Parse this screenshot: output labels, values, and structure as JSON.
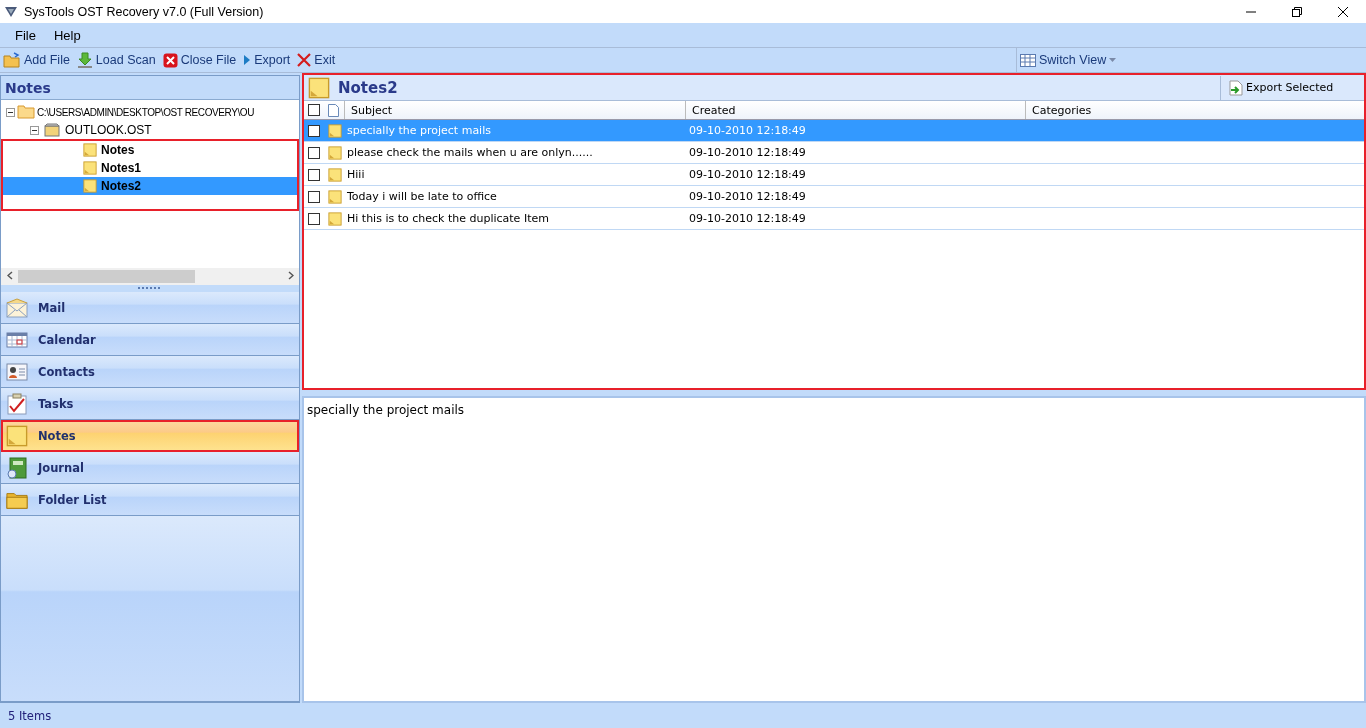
{
  "window": {
    "title": "SysTools OST Recovery v7.0 (Full Version)"
  },
  "menu": [
    "File",
    "Help"
  ],
  "toolbar": [
    {
      "kind": "add",
      "label": "Add File"
    },
    {
      "kind": "load",
      "label": "Load Scan"
    },
    {
      "kind": "close",
      "label": "Close File"
    },
    {
      "kind": "export",
      "label": "Export"
    },
    {
      "kind": "exit",
      "label": "Exit"
    }
  ],
  "switch_view": {
    "label": "Switch View"
  },
  "left_panel": {
    "title": "Notes"
  },
  "tree": [
    {
      "label": "C:\\USERS\\ADMIN\\DESKTOP\\OST RECOVERY\\OU",
      "kind": "folder",
      "expanded": true,
      "selected": false,
      "children": [
        {
          "label": "OUTLOOK.OST",
          "kind": "store",
          "expanded": true,
          "selected": false,
          "children": [
            {
              "label": "Notes",
              "kind": "note",
              "selected": false
            },
            {
              "label": "Notes1",
              "kind": "note",
              "selected": false
            },
            {
              "label": "Notes2",
              "kind": "note",
              "selected": true
            }
          ]
        }
      ]
    }
  ],
  "nav": [
    {
      "kind": "mail",
      "label": "Mail",
      "selected": false
    },
    {
      "kind": "calendar",
      "label": "Calendar",
      "selected": false
    },
    {
      "kind": "contacts",
      "label": "Contacts",
      "selected": false
    },
    {
      "kind": "tasks",
      "label": "Tasks",
      "selected": false
    },
    {
      "kind": "notes",
      "label": "Notes",
      "selected": true
    },
    {
      "kind": "journal",
      "label": "Journal",
      "selected": false
    },
    {
      "kind": "folder",
      "label": "Folder List",
      "selected": false
    }
  ],
  "content": {
    "title": "Notes2",
    "export_button": "Export Selected"
  },
  "table": {
    "select_all": {
      "checked": false
    },
    "columns": [
      "Subject",
      "Created",
      "Categories"
    ],
    "rows": [
      {
        "subject": "specially the project mails",
        "created": "09-10-2010 12:18:49",
        "checked": false,
        "selected": true
      },
      {
        "subject": "please check the mails when u are onlyn......",
        "created": "09-10-2010 12:18:49",
        "checked": false,
        "selected": false
      },
      {
        "subject": "Hiii",
        "created": "09-10-2010 12:18:49",
        "checked": false,
        "selected": false
      },
      {
        "subject": "Today i will be late to office",
        "created": "09-10-2010 12:18:49",
        "checked": false,
        "selected": false
      },
      {
        "subject": "Hi this is to check the duplicate Item",
        "created": "09-10-2010 12:18:49",
        "checked": false,
        "selected": false
      }
    ]
  },
  "preview": {
    "text": "specially the project mails"
  },
  "status_bar": {
    "text": "5 Items"
  }
}
